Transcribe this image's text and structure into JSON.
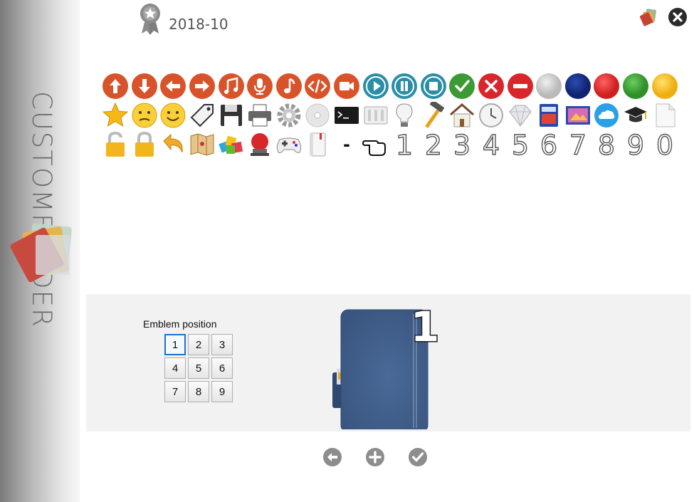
{
  "sidebar": {
    "title": "CUSTOMFOLDER",
    "logo_icon": "folder-stack-logo-icon"
  },
  "header": {
    "version": "2018-10",
    "badge_icon": "award-badge-icon",
    "app_icon": "app-folder-icon",
    "close_icon": "close-icon"
  },
  "emblems": {
    "rows": [
      [
        "arrow-up-icon",
        "arrow-down-icon",
        "arrow-left-icon",
        "arrow-right-icon",
        "music-notes-icon",
        "microphone-icon",
        "music-note-icon",
        "code-icon",
        "video-camera-icon",
        "play-icon",
        "pause-icon",
        "stop-icon",
        "check-icon",
        "cross-icon",
        "minus-icon",
        "gray-dot-icon",
        "navy-dot-icon",
        "red-dot-icon",
        "green-dot-icon",
        "yellow-dot-icon"
      ],
      [
        "star-icon",
        "neutral-face-icon",
        "smiley-face-icon",
        "tag-icon",
        "floppy-disk-icon",
        "printer-icon",
        "gear-icon",
        "disc-icon",
        "terminal-icon",
        "server-icon",
        "lightbulb-icon",
        "hammer-icon",
        "house-icon",
        "clock-icon",
        "diamond-icon",
        "calculator-icon",
        "image-icon",
        "cloud-icon",
        "graduation-cap-icon",
        "document-icon"
      ],
      [
        "unlocked-padlock-icon",
        "locked-padlock-icon",
        "return-arrow-icon",
        "map-icon",
        "color-blocks-icon",
        "alarm-bell-icon",
        "gamepad-icon",
        "notebook-icon",
        "dash-icon",
        "pointing-hand-icon",
        "digit-1-icon",
        "digit-2-icon",
        "digit-3-icon",
        "digit-4-icon",
        "digit-5-icon",
        "digit-6-icon",
        "digit-7-icon",
        "digit-8-icon",
        "digit-9-icon",
        "digit-0-icon"
      ]
    ],
    "digits": [
      "1",
      "2",
      "3",
      "4",
      "5",
      "6",
      "7",
      "8",
      "9",
      "0"
    ],
    "dash": "-",
    "colors": {
      "orange": "#d8522a",
      "teal": "#2a8ea6",
      "green": "#3c9a34",
      "red": "#d9262a",
      "gray_dot": "#c9c9c9",
      "navy_dot": "#142f86",
      "red_dot": "#e02a2a",
      "green_dot": "#3ea534",
      "yellow_dot": "#f7c21c"
    }
  },
  "preview": {
    "position_label": "Emblem position",
    "positions": [
      "1",
      "2",
      "3",
      "4",
      "5",
      "6",
      "7",
      "8",
      "9"
    ],
    "selected_position": "1",
    "folder_emblem": "1",
    "folder_icon": "blue-folder-icon",
    "folder_color": "#3f5b85"
  },
  "actions": {
    "back_icon": "back-arrow-icon",
    "add_icon": "add-icon",
    "apply_icon": "apply-check-icon"
  }
}
